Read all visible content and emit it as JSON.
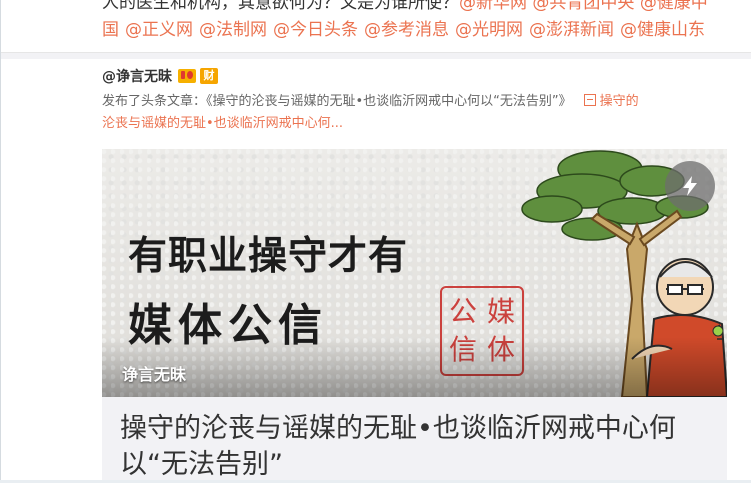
{
  "post": {
    "line1_text": "人的医生和机构，其意欲何为？又是为谁所使？",
    "line1_mentions": [
      "@新华网",
      "@共青团中央",
      "@健康中"
    ],
    "line2_mentions": [
      "国",
      "@正义网",
      "@法制网",
      "@今日头条",
      "@参考消息",
      "@光明网",
      "@澎湃新闻",
      "@健康山东"
    ]
  },
  "repost": {
    "author": "@诤言无昧",
    "badge_cai": "财",
    "text_prefix": "发布了头条文章：《操守的沦丧与谣媒的无耻•也谈临沂网戒中心何以“无法告别”》",
    "link_text": "操守的",
    "text_cont": "沦丧与谣媒的无耻•也谈临沂网戒中心何...",
    "link_icon": "article-icon"
  },
  "cover": {
    "line1": "有职业操守才有",
    "line2": "媒体公信",
    "seal_chars": [
      "公",
      "媒",
      "信",
      "体"
    ],
    "label": "诤言无昧",
    "flash_icon": "lightning-icon"
  },
  "article": {
    "title": "操守的沦丧与谣媒的无耻•也谈临沂网戒中心何以“无法告别”"
  },
  "colors": {
    "accent": "#eb7350",
    "badge": "#f6a500"
  }
}
